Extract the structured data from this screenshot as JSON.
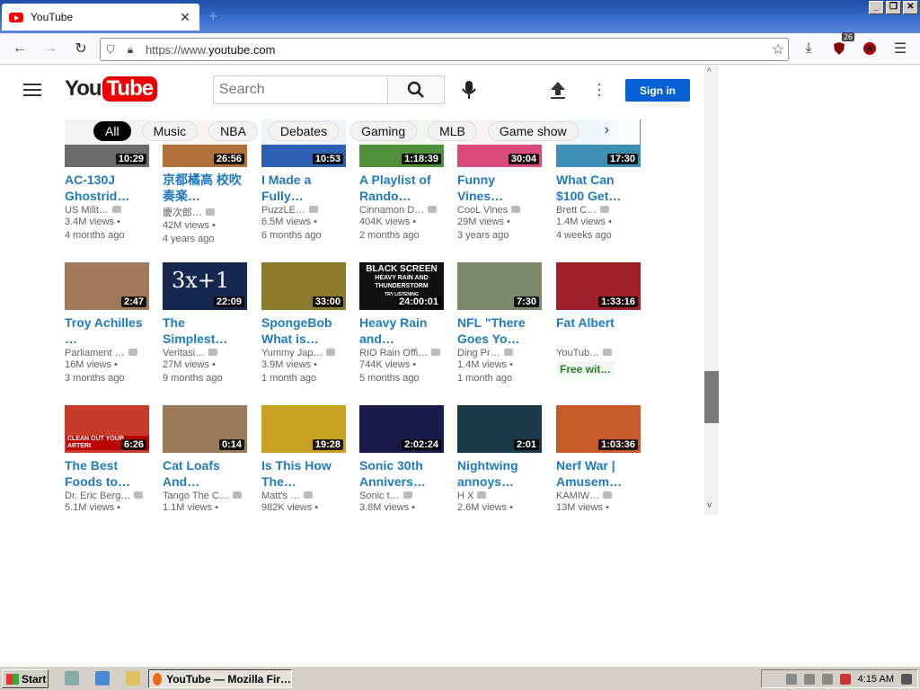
{
  "browser": {
    "tab_title": "YouTube",
    "url_prefix": "https://www.",
    "url_domain": "youtube.com",
    "extension_badge": "26"
  },
  "youtube": {
    "search_placeholder": "Search",
    "sign_in": "Sign in",
    "logo_you": "You",
    "logo_tube": "Tube",
    "chips": [
      "All",
      "Music",
      "NBA",
      "Debates",
      "Gaming",
      "MLB",
      "Game show"
    ],
    "videos": [
      {
        "title": "AC-130J Ghostrid…",
        "channel": "US Milit…",
        "views": "3.4M views •",
        "age": "4 months ago",
        "duration": "10:29",
        "color": "#6b6b6b"
      },
      {
        "title": "京都橘高 校吹奏楽…",
        "channel": "慶次郎…",
        "views": "42M views •",
        "age": "4 years ago",
        "duration": "26:56",
        "color": "#b0703a"
      },
      {
        "title": "I Made a Fully…",
        "channel": "PuzzLE…",
        "views": "6.5M views •",
        "age": "6 months ago",
        "duration": "10:53",
        "color": "#2d5fb5"
      },
      {
        "title": "A Playlist of Rando…",
        "channel": "Cinnamon D…",
        "views": "404K views •",
        "age": "2 months ago",
        "duration": "1:18:39",
        "color": "#4e8f3c"
      },
      {
        "title": "Funny Vines…",
        "channel": "CooL Vines",
        "views": "29M views •",
        "age": "3 years ago",
        "duration": "30:04",
        "color": "#d84a7a"
      },
      {
        "title": "What Can $100 Get…",
        "channel": "Brett C…",
        "views": "1.4M views •",
        "age": "4 weeks ago",
        "duration": "17:30",
        "color": "#3c8fb0"
      },
      {
        "title": "Troy Achilles …",
        "channel": "Parliament …",
        "views": "16M views •",
        "age": "3 months ago",
        "duration": "2:47",
        "color": "#a0785a"
      },
      {
        "title": "The Simplest…",
        "channel": "Veritasi…",
        "views": "27M views •",
        "age": "9 months ago",
        "duration": "22:09",
        "color": "#142850"
      },
      {
        "title": "SpongeBob What is…",
        "channel": "Yummy Jap…",
        "views": "3.9M views •",
        "age": "1 month ago",
        "duration": "33:00",
        "color": "#8a7a2a"
      },
      {
        "title": "Heavy Rain and…",
        "channel": "RIO Rain Offi…",
        "views": "744K views •",
        "age": "5 months ago",
        "duration": "24:00:01",
        "color": "#111111"
      },
      {
        "title": "NFL \"There Goes Yo…",
        "channel": "Ding Pr…",
        "views": "1.4M views •",
        "age": "1 month ago",
        "duration": "7:30",
        "color": "#7a8a6a"
      },
      {
        "title": "Fat Albert",
        "channel": "YouTub…",
        "views": "",
        "age": "",
        "duration": "1:33:16",
        "color": "#a0202a",
        "free": "Free wit…"
      },
      {
        "title": "The Best Foods to…",
        "channel": "Dr. Eric Berg…",
        "views": "5.1M views •",
        "age": "",
        "duration": "6:26",
        "color": "#c83a2a"
      },
      {
        "title": "Cat Loafs And…",
        "channel": "Tango The C…",
        "views": "1.1M views •",
        "age": "",
        "duration": "0:14",
        "color": "#9a7a5a"
      },
      {
        "title": "Is This How The…",
        "channel": "Matt's …",
        "views": "982K views •",
        "age": "",
        "duration": "19:28",
        "color": "#c8a020"
      },
      {
        "title": "Sonic 30th Annivers…",
        "channel": "Sonic t…",
        "views": "3.8M views •",
        "age": "",
        "duration": "2:02:24",
        "color": "#1a1a4a"
      },
      {
        "title": "Nightwing annoys…",
        "channel": "H X",
        "views": "2.6M views •",
        "age": "",
        "duration": "2:01",
        "color": "#1a3a4a"
      },
      {
        "title": "Nerf War | Amusem…",
        "channel": "KAMIW…",
        "views": "13M views •",
        "age": "",
        "duration": "1:03:36",
        "color": "#c85a2a"
      }
    ],
    "thumb_texts": {
      "simplest": "3x+1",
      "heavy_rain_1": "BLACK SCREEN",
      "heavy_rain_2": "HEAVY RAIN AND THUNDERSTORM",
      "heavy_rain_3": "TRY LISTENING",
      "best_foods": "CLEAN OUT YOUR ARTERI"
    }
  },
  "taskbar": {
    "start": "Start",
    "task_label": "YouTube — Mozilla Fir…",
    "clock": "4:15 AM"
  }
}
